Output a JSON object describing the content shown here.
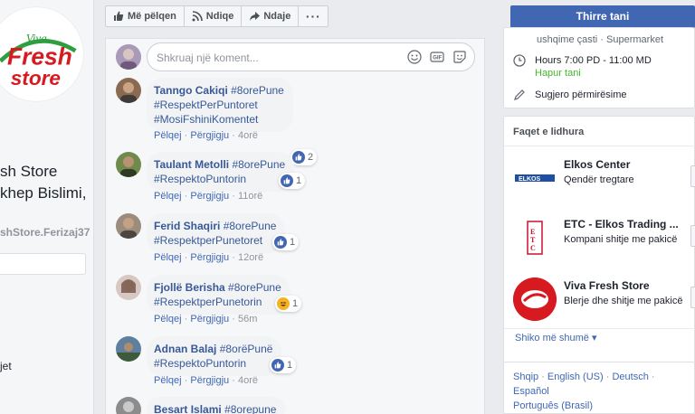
{
  "left": {
    "page_name_line1": "sh Store",
    "page_name_line2": "khep Bislimi,",
    "handle": "shStore.Ferizaj37",
    "nav_item": "jet",
    "logo_text_top": "Viva",
    "logo_text_main": "Fresh",
    "logo_text_bottom": "store"
  },
  "action_bar": {
    "like_label": "Më pëlqen",
    "follow_label": "Ndiqe",
    "share_label": "Ndaje",
    "more_label": "···"
  },
  "composer": {
    "placeholder": "Shkruaj një koment..."
  },
  "comments": [
    {
      "author": "Tanngo Cakiqi",
      "line1_tag": "#8orePune",
      "line2": "#RespektPerPuntoret",
      "line3": "#MosiFshiniKomentet",
      "reaction_count": "2",
      "reaction": "like",
      "like": "Pëlqej",
      "reply": "Përgjigju",
      "time": "4orë"
    },
    {
      "author": "Taulant Metolli",
      "line1_tag": "#8orePune",
      "line2": "#RespektoPuntorin",
      "reaction_count": "1",
      "reaction": "like",
      "like": "Pëlqej",
      "reply": "Përgjigju",
      "time": "11orë"
    },
    {
      "author": "Ferid Shaqiri",
      "line1_tag": "#8orePune",
      "line2": "#RespektperPunetoret",
      "reaction_count": "1",
      "reaction": "like",
      "like": "Pëlqej",
      "reply": "Përgjigju",
      "time": "12orë"
    },
    {
      "author": "Fjollë Berisha",
      "line1_tag": "#8orePune",
      "line2": "#RespektperPunetorin",
      "reaction_count": "1",
      "reaction": "haha",
      "like": "Pëlqej",
      "reply": "Përgjigju",
      "time": "56m"
    },
    {
      "author": "Adnan Balaj",
      "line1_tag": "#8orëPunë",
      "line2": "#RespektoPuntorin",
      "reaction_count": "1",
      "reaction": "like",
      "like": "Pëlqej",
      "reply": "Përgjigju",
      "time": "4orë"
    },
    {
      "author": "Besart Islami",
      "line1_tag": "#8orepune"
    }
  ],
  "call_button": "Thirre tani",
  "info": {
    "category": "ushqime çasti · Supermarket",
    "hours": "Hours 7:00 PD - 11:00 MD",
    "open_now": "Hapur tani",
    "suggest": "Sugjero përmirësime"
  },
  "related": {
    "title": "Faqet e lidhura",
    "items": [
      {
        "name": "Elkos Center",
        "subtitle": "Qendër tregtare"
      },
      {
        "name": "ETC - Elkos Trading ...",
        "subtitle": "Kompani shitje me pakicë"
      },
      {
        "name": "Viva Fresh Store",
        "subtitle": "Blerje dhe shitje me pakicë"
      }
    ],
    "see_more": "Shiko më shumë ▾"
  },
  "languages": {
    "line1": [
      "Shqip",
      "English (US)",
      "Deutsch",
      "Español"
    ],
    "line2": "Português (Brasil)",
    "sep": " · "
  },
  "colors": {
    "fb_blue": "#4267b2",
    "link_blue": "#385898",
    "open_green": "#42b72a",
    "logo_red": "#d71920",
    "logo_green": "#2e9e3e"
  }
}
